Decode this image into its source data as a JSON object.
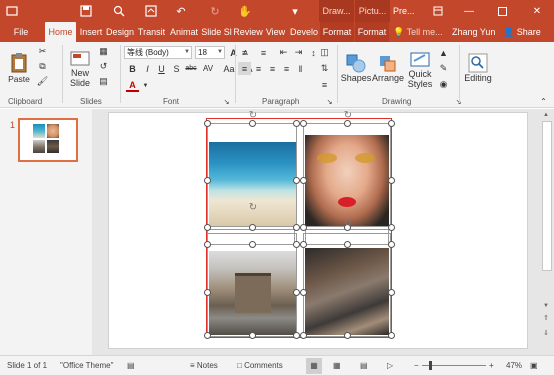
{
  "title_bar": {
    "context_tabs": [
      "Draw...",
      "Pictu..."
    ],
    "title_short": "Pre...",
    "qat": [
      "new-file-icon",
      "save-icon",
      "print-preview-icon",
      "screenshot-icon",
      "undo-icon",
      "redo-icon",
      "touch-mode-icon",
      "customize-icon"
    ]
  },
  "ribbon_tabs": [
    {
      "label": "File"
    },
    {
      "label": "Home",
      "active": true
    },
    {
      "label": "Insert"
    },
    {
      "label": "Design"
    },
    {
      "label": "Transit"
    },
    {
      "label": "Animat"
    },
    {
      "label": "Slide Sl"
    },
    {
      "label": "Review"
    },
    {
      "label": "View"
    },
    {
      "label": "Develo"
    },
    {
      "label": "Format"
    },
    {
      "label": "Format"
    }
  ],
  "tell_me": "Tell me...",
  "user": "Zhang Yun",
  "share": "Share",
  "groups": {
    "clipboard": {
      "label": "Clipboard",
      "paste": "Paste"
    },
    "slides": {
      "label": "Slides",
      "new_slide_1": "New",
      "new_slide_2": "Slide"
    },
    "font": {
      "label": "Font",
      "font_name": "等线 (Body)",
      "font_size": "18",
      "bold": "B",
      "italic": "I",
      "underline": "U",
      "strike": "S",
      "shadow": "abc",
      "spacing": "AV",
      "case": "Aa",
      "clear": "A",
      "grow": "A",
      "shrink": "A"
    },
    "paragraph": {
      "label": "Paragraph"
    },
    "drawing": {
      "label": "Drawing",
      "shapes": "Shapes",
      "arrange": "Arrange",
      "quick_1": "Quick",
      "quick_2": "Styles"
    },
    "editing": {
      "label": "Editing"
    }
  },
  "thumbnail": {
    "number": "1"
  },
  "status": {
    "slide_info": "Slide 1 of 1",
    "theme": "\"Office Theme\"",
    "notes": "Notes",
    "comments": "Comments",
    "zoom": "47%"
  },
  "colors": {
    "accent": "#c3472a",
    "ribbon": "#f3f3f3",
    "selection": "#e0302a"
  }
}
